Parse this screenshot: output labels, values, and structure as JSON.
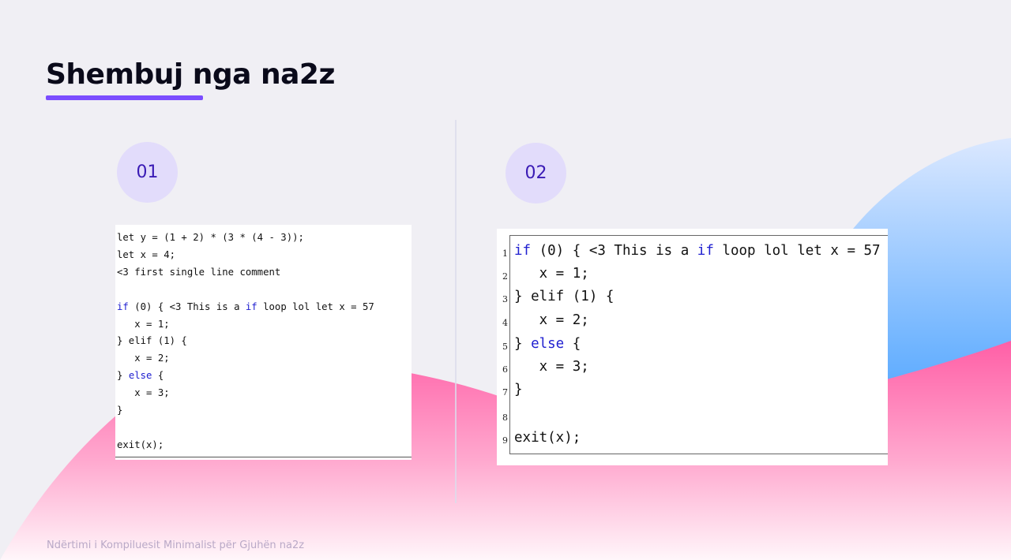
{
  "slide": {
    "title": "Shembuj nga na2z",
    "footer": "Ndërtimi i Kompiluesit Minimalist për Gjuhën na2z"
  },
  "examples": [
    {
      "number": "01",
      "lines": [
        "let y = (1 + 2) * (3 * (4 - 3));",
        "let x = 4;",
        "<3 first single line comment",
        "",
        "if (0) { <3 This is a if loop lol let x = 57",
        "   x = 1;",
        "} elif (1) {",
        "   x = 2;",
        "} else {",
        "   x = 3;",
        "}",
        "",
        "exit(x);"
      ]
    },
    {
      "number": "02",
      "line_numbers": [
        "1",
        "2",
        "3",
        "4",
        "5",
        "6",
        "7",
        "8",
        "9"
      ],
      "lines": [
        "if (0) { <3 This is a if loop lol let x = 57",
        "   x = 1;",
        "} elif (1) {",
        "   x = 2;",
        "} else {",
        "   x = 3;",
        "}",
        "",
        "exit(x);"
      ]
    }
  ],
  "colors": {
    "accent": "#7b4dff",
    "keyword": "#2020d0",
    "pink": "#ff6fae",
    "blue": "#1f8fff",
    "circle": "#e2dcfb"
  }
}
